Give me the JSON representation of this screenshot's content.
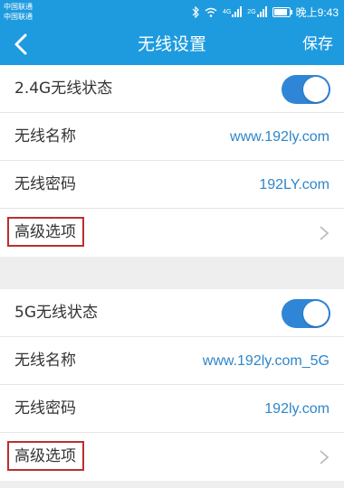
{
  "status_bar": {
    "carrier1": "中国联通",
    "carrier2": "中国联通",
    "network1": "4G",
    "network2": "2G",
    "time": "晚上9:43"
  },
  "nav": {
    "title": "无线设置",
    "save_label": "保存"
  },
  "sections": [
    {
      "status_label": "2.4G无线状态",
      "toggle_on": true,
      "name_label": "无线名称",
      "name_value": "www.192ly.com",
      "password_label": "无线密码",
      "password_value": "192LY.com",
      "advanced_label": "高级选项"
    },
    {
      "status_label": "5G无线状态",
      "toggle_on": true,
      "name_label": "无线名称",
      "name_value": "www.192ly.com_5G",
      "password_label": "无线密码",
      "password_value": "192ly.com",
      "advanced_label": "高级选项"
    }
  ],
  "colors": {
    "accent": "#1e9bdf",
    "toggle_on": "#2f86d6",
    "value_text": "#2f86c9",
    "highlight_box": "#b9302f"
  }
}
